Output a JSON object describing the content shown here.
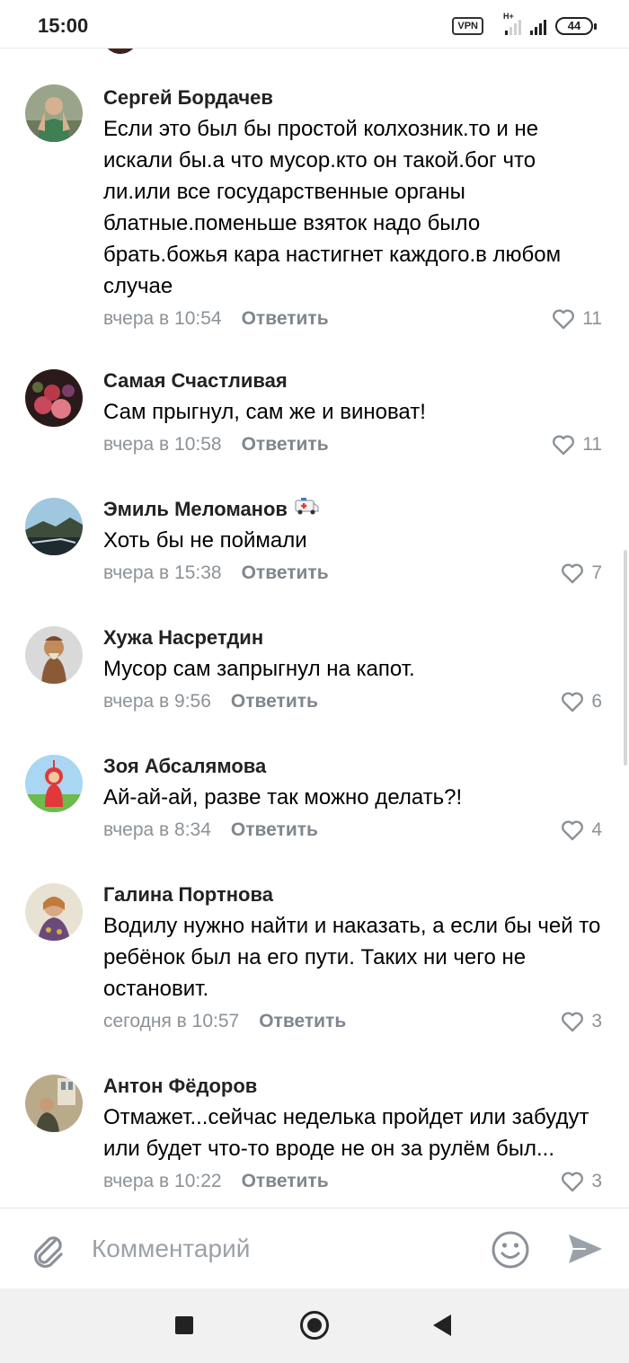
{
  "status_bar": {
    "time": "15:00",
    "vpn": "VPN",
    "network_type": "H+",
    "battery": "44"
  },
  "comments": [
    {
      "author": "Сергей Бордачев",
      "text": "Если это был бы простой колхозник.то и не искали бы.а что мусор.кто он такой.бог что ли.или все государственные органы блатные.поменьше взяток надо было брать.божья кара настигнет каждого.в любом случае",
      "date": "вчера в 10:54",
      "reply": "Ответить",
      "likes": "11"
    },
    {
      "author": "Самая Счастливая",
      "text": "Сам прыгнул, сам же и виноват!",
      "date": "вчера в 10:58",
      "reply": "Ответить",
      "likes": "11"
    },
    {
      "author": "Эмиль Меломанов",
      "author_emoji": "ambulance-icon",
      "text": "Хоть бы не поймали",
      "date": "вчера в 15:38",
      "reply": "Ответить",
      "likes": "7"
    },
    {
      "author": "Хужа Насретдин",
      "text": "Мусор сам запрыгнул на капот.",
      "date": "вчера в 9:56",
      "reply": "Ответить",
      "likes": "6"
    },
    {
      "author": "Зоя Абсалямова",
      "text": "Ай-ай-ай, разве так можно делать?!",
      "date": "вчера в 8:34",
      "reply": "Ответить",
      "likes": "4"
    },
    {
      "author": "Галина Портнова",
      "text": "Водилу нужно найти и наказать, а если бы чей то ребёнок был на его пути. Таких ни чего не остановит.",
      "date": "сегодня в 10:57",
      "reply": "Ответить",
      "likes": "3"
    },
    {
      "author": "Антон Фёдоров",
      "text": "Отмажет...сейчас неделька пройдет или забудут или будет что-то вроде не он за рулём был...",
      "date": "вчера в 10:22",
      "reply": "Ответить",
      "likes": "3"
    }
  ],
  "input": {
    "placeholder": "Комментарий"
  },
  "colors": {
    "meta_text": "#8b9298",
    "accent_icon": "#8a9199"
  }
}
